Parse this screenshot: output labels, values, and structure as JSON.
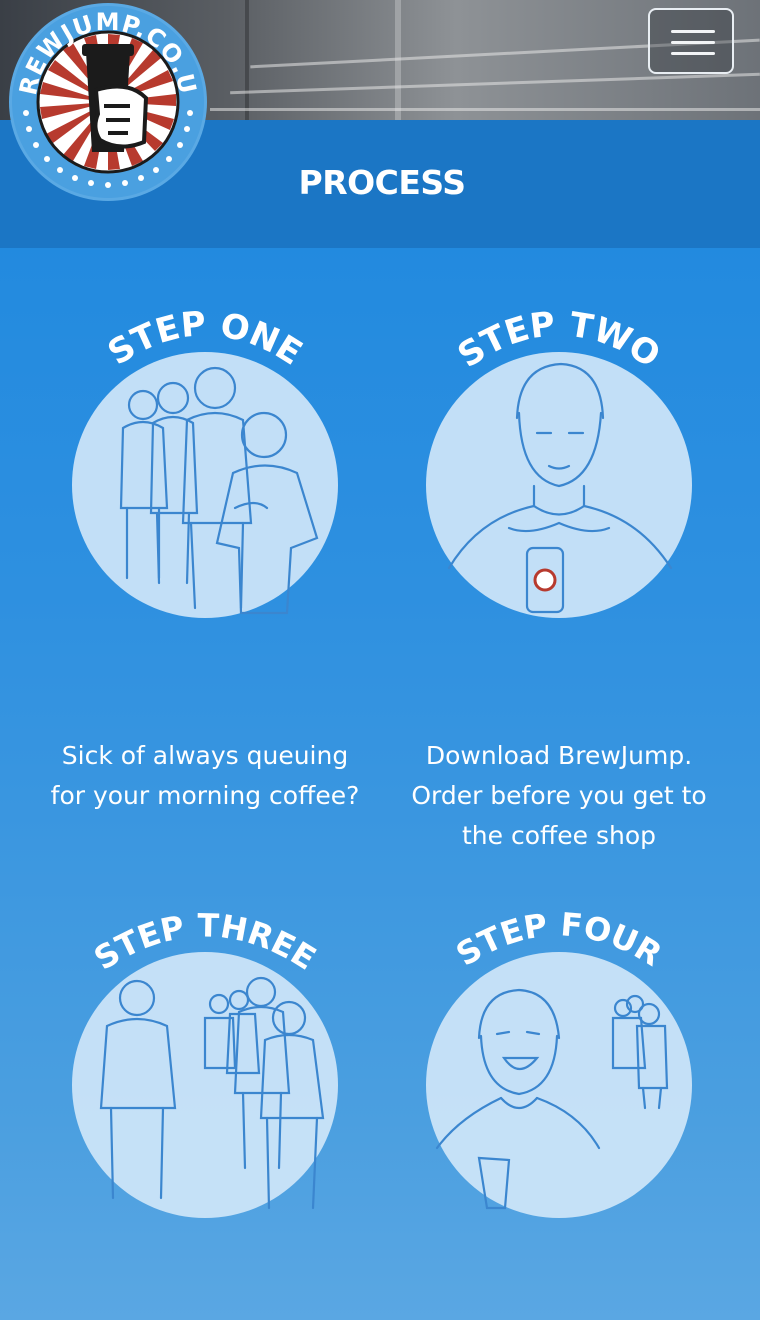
{
  "brand": {
    "logo_text": "BREWJUMP.CO.UK"
  },
  "header": {
    "title": "PROCESS"
  },
  "steps": [
    {
      "heading": "STEP ONE",
      "caption": "Sick of always queuing for your morning coffee?"
    },
    {
      "heading": "STEP TWO",
      "caption": "Download BrewJump. Order before you get to the coffee shop"
    },
    {
      "heading": "STEP THREE",
      "caption": ""
    },
    {
      "heading": "STEP FOUR",
      "caption": ""
    }
  ],
  "colors": {
    "background": "#1a86de",
    "title_bar": "#1b76c5",
    "circle": "#cfe6f8",
    "line_art": "#3b86cf",
    "text": "#ffffff"
  }
}
